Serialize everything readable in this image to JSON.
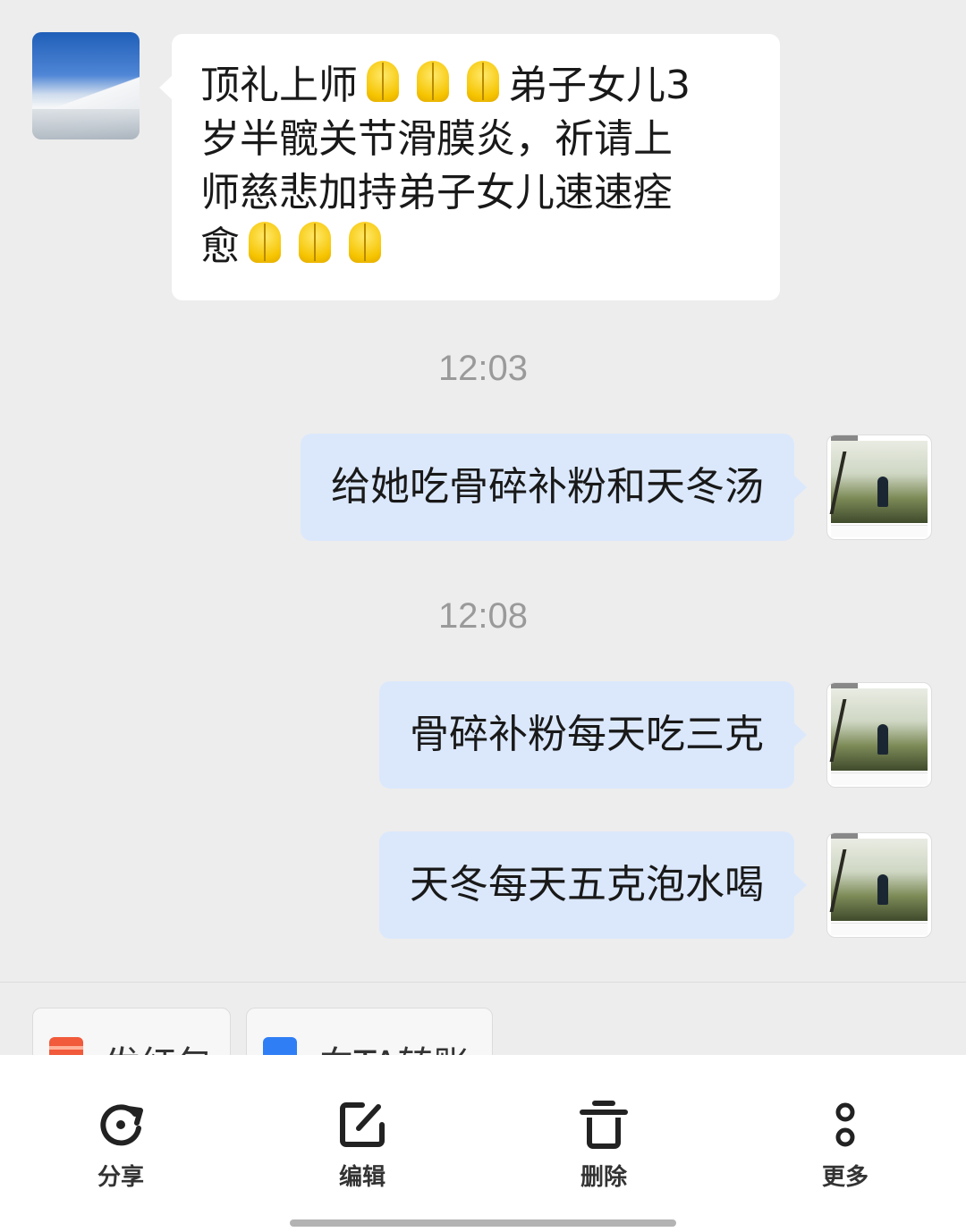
{
  "messages": [
    {
      "direction": "incoming",
      "lines": [
        {
          "text_a": "顶礼上师",
          "emoji_count": 3,
          "text_b": "弟子女儿3"
        },
        {
          "text_a": "岁半髋关节滑膜炎，祈请上"
        },
        {
          "text_a": "师慈悲加持弟子女儿速速痊"
        },
        {
          "text_a": "愈",
          "emoji_count": 3
        }
      ]
    },
    {
      "time": "12:03"
    },
    {
      "direction": "outgoing",
      "text": "给她吃骨碎补粉和天冬汤"
    },
    {
      "time": "12:08"
    },
    {
      "direction": "outgoing",
      "text": "骨碎补粉每天吃三克"
    },
    {
      "direction": "outgoing",
      "text": "天冬每天五克泡水喝"
    }
  ],
  "quick_actions": [
    {
      "label": "发红包",
      "icon": "red-packet-icon",
      "color": "#f15a3a"
    },
    {
      "label": "向TA转账",
      "icon": "transfer-icon",
      "color": "#2f7ef5"
    }
  ],
  "toolbar": [
    {
      "label": "分享",
      "icon": "share-icon"
    },
    {
      "label": "编辑",
      "icon": "edit-icon"
    },
    {
      "label": "删除",
      "icon": "delete-icon"
    },
    {
      "label": "更多",
      "icon": "more-icon"
    }
  ]
}
